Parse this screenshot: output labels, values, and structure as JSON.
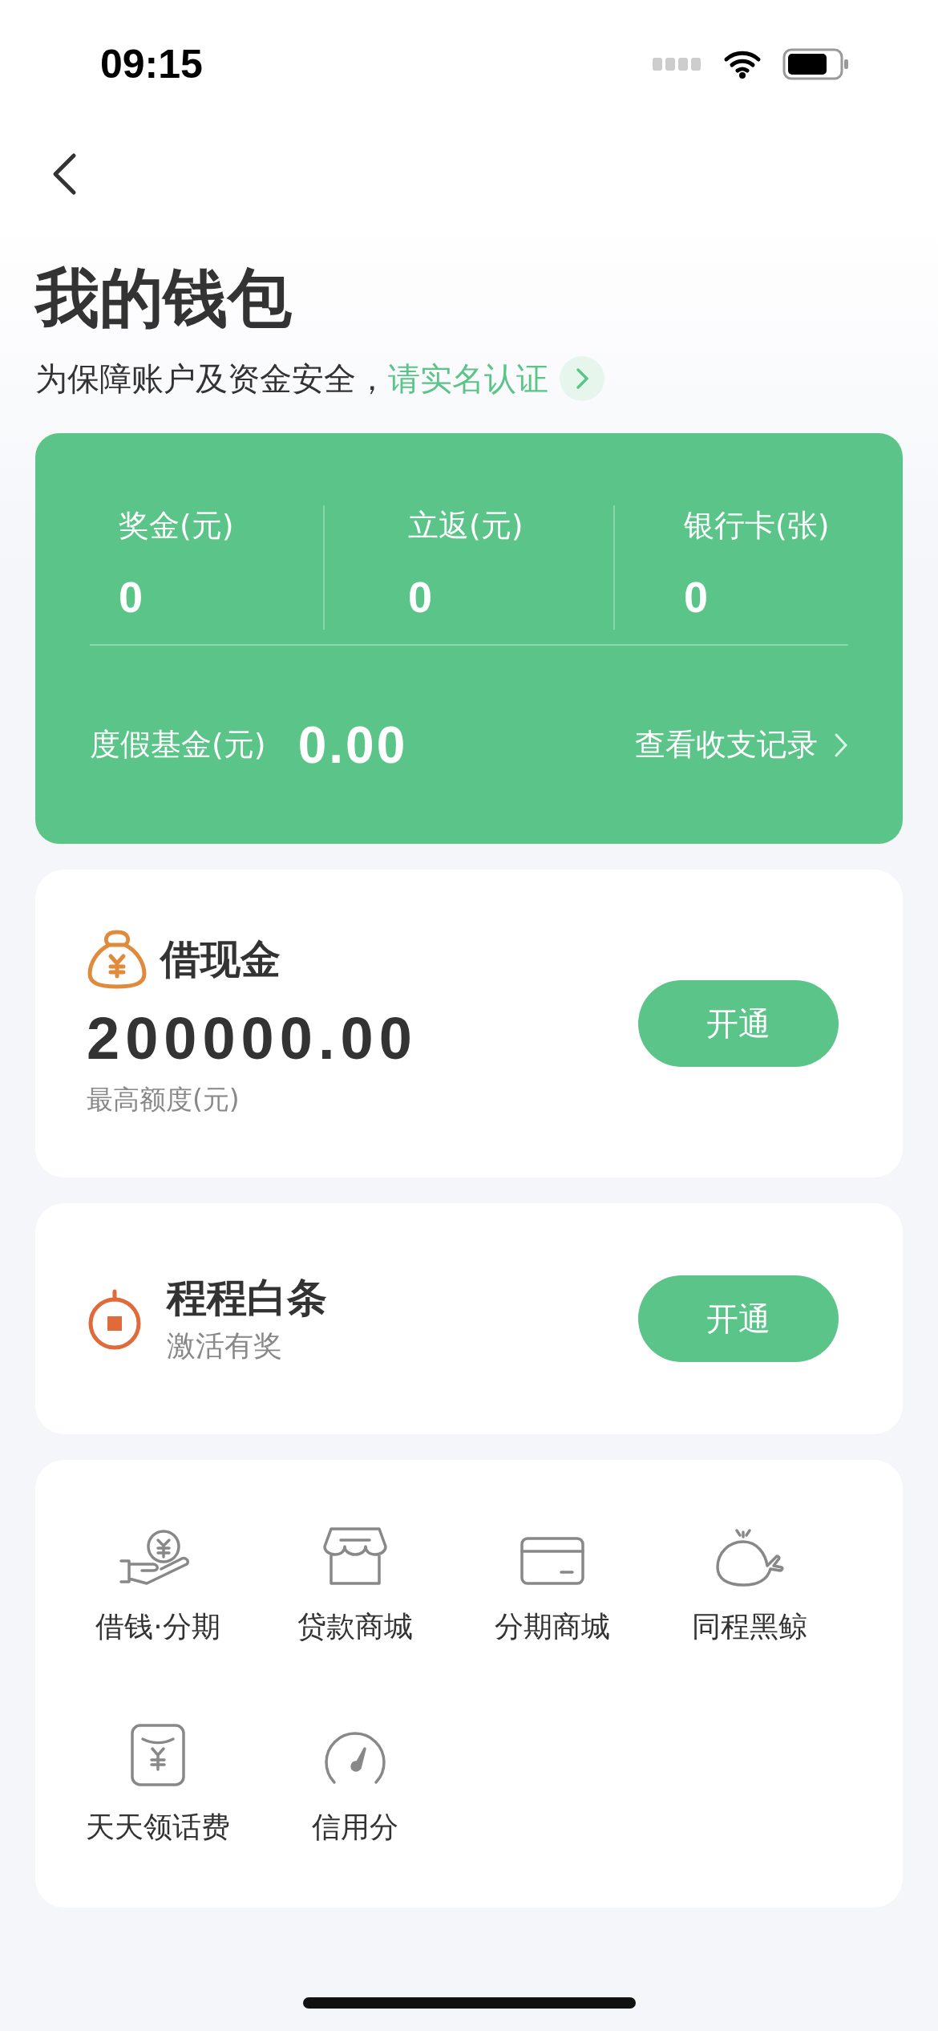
{
  "status_bar": {
    "time": "09:15"
  },
  "title": "我的钱包",
  "notice": {
    "text": "为保障账户及资金安全，",
    "link": "请实名认证"
  },
  "summary": {
    "stats": [
      {
        "label": "奖金(元)",
        "value": "0"
      },
      {
        "label": "立返(元)",
        "value": "0"
      },
      {
        "label": "银行卡(张)",
        "value": "0"
      }
    ],
    "fund_label": "度假基金(元)",
    "fund_value": "0.00",
    "records_link": "查看收支记录"
  },
  "cash_loan": {
    "title": "借现金",
    "amount": "200000.00",
    "caption": "最高额度(元)",
    "button": "开通"
  },
  "credit": {
    "title": "程程白条",
    "subtitle": "激活有奖",
    "button": "开通"
  },
  "services": [
    {
      "label": "借钱·分期"
    },
    {
      "label": "贷款商城"
    },
    {
      "label": "分期商城"
    },
    {
      "label": "同程黑鲸"
    },
    {
      "label": "天天领话费"
    },
    {
      "label": "信用分"
    }
  ]
}
